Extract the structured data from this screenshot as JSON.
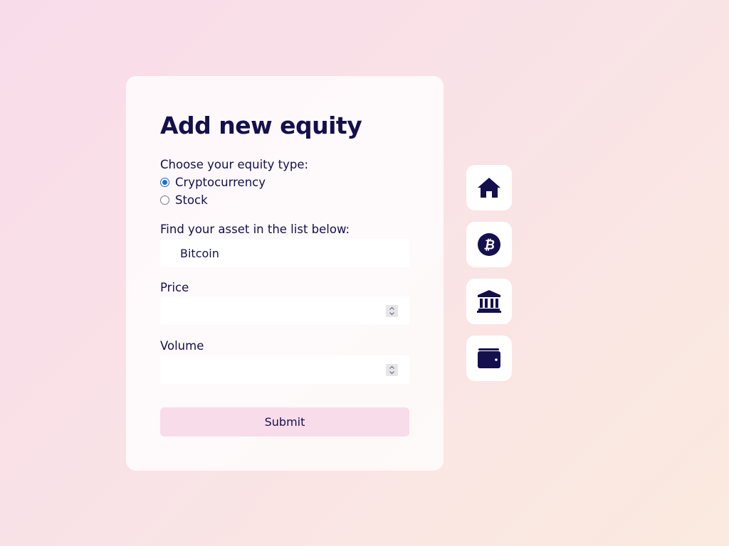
{
  "form": {
    "title": "Add new equity",
    "equity_type_label": "Choose your equity type:",
    "equity_options": [
      {
        "label": "Cryptocurrency",
        "checked": true
      },
      {
        "label": "Stock",
        "checked": false
      }
    ],
    "asset_label": "Find your asset in the list below:",
    "asset_value": "Bitcoin",
    "price_label": "Price",
    "price_value": "",
    "volume_label": "Volume",
    "volume_value": "",
    "submit_label": "Submit"
  },
  "nav": {
    "items": [
      {
        "icon": "home-icon"
      },
      {
        "icon": "bitcoin-icon"
      },
      {
        "icon": "bank-icon"
      },
      {
        "icon": "wallet-icon"
      }
    ]
  },
  "colors": {
    "primary_text": "#14104d",
    "accent": "#1a6fe0",
    "submit_bg": "#f8dcea"
  }
}
